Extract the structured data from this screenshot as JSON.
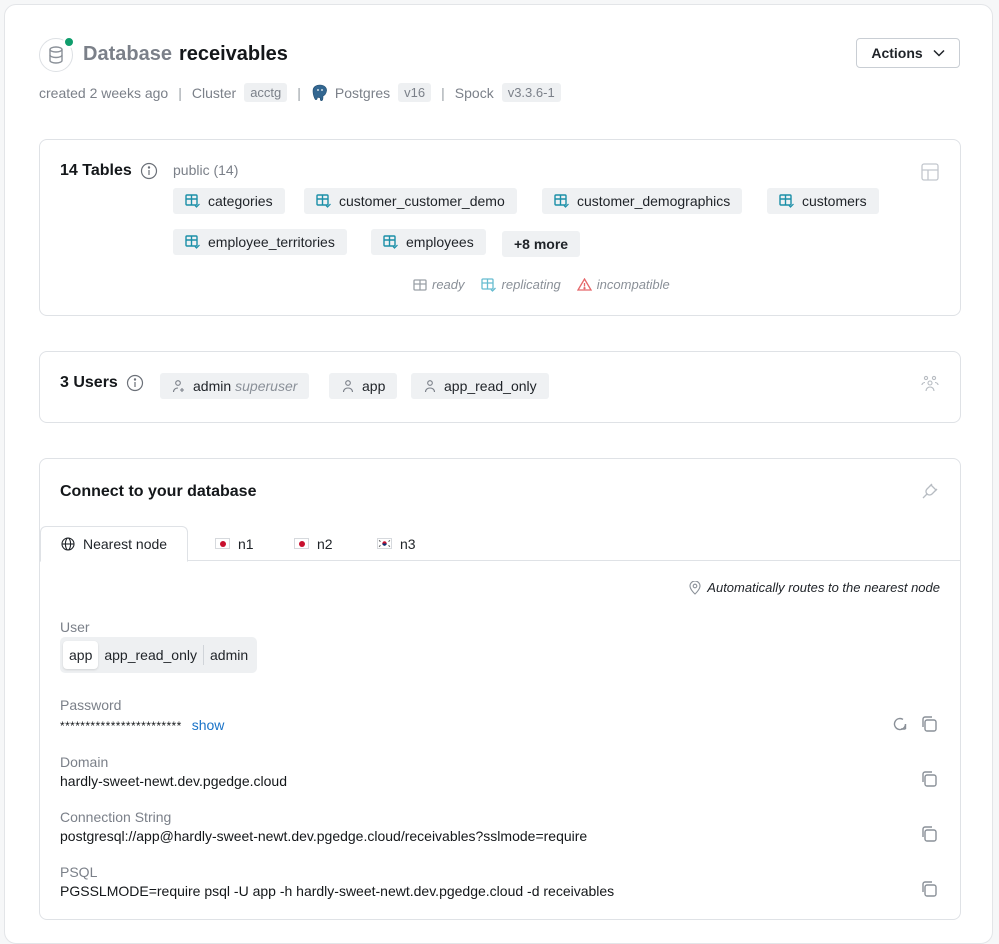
{
  "header": {
    "kind_label": "Database",
    "name": "receivables",
    "status_color": "#0f9d6c",
    "created": "created 2 weeks ago",
    "sep": "|",
    "cluster_label": "Cluster",
    "cluster_value": "acctg",
    "engine_label": "Postgres",
    "engine_version": "v16",
    "spock_label": "Spock",
    "spock_version": "v3.3.6-1",
    "actions_label": "Actions"
  },
  "tables": {
    "title": "14 Tables",
    "schema": "public (14)",
    "items": [
      "categories",
      "customer_customer_demo",
      "customer_demographics",
      "customers",
      "employee_territories",
      "employees"
    ],
    "more_label": "+8 more",
    "legend": {
      "ready": "ready",
      "replicating": "replicating",
      "incompatible": "incompatible"
    }
  },
  "users": {
    "title": "3 Users",
    "items": [
      {
        "name": "admin",
        "role": "superuser"
      },
      {
        "name": "app",
        "role": ""
      },
      {
        "name": "app_read_only",
        "role": ""
      }
    ]
  },
  "connect": {
    "title": "Connect to your database",
    "tabs": [
      {
        "label": "Nearest node",
        "icon": "globe-icon",
        "active": true
      },
      {
        "label": "n1",
        "icon": "flag-japan-icon",
        "active": false
      },
      {
        "label": "n2",
        "icon": "flag-japan-icon",
        "active": false
      },
      {
        "label": "n3",
        "icon": "flag-korea-icon",
        "active": false
      }
    ],
    "route_note": "Automatically routes to the nearest node",
    "user_label": "User",
    "user_options": [
      "app",
      "app_read_only",
      "admin"
    ],
    "user_selected": "app",
    "password_label": "Password",
    "password_value": "************************",
    "show_label": "show",
    "domain_label": "Domain",
    "domain_value": "hardly-sweet-newt.dev.pgedge.cloud",
    "conn_label": "Connection String",
    "conn_value": "postgresql://app@hardly-sweet-newt.dev.pgedge.cloud/receivables?sslmode=require",
    "psql_label": "PSQL",
    "psql_value": "PGSSLMODE=require psql -U app -h hardly-sweet-newt.dev.pgedge.cloud -d receivables"
  }
}
